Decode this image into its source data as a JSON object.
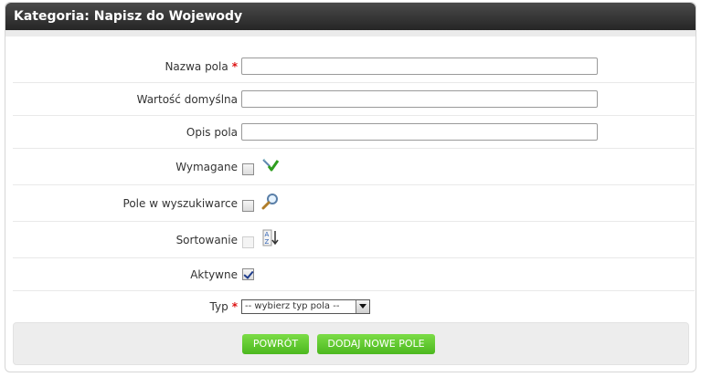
{
  "header": {
    "title": "Kategoria: Napisz do Wojewody"
  },
  "fields": {
    "nazwa": {
      "label": "Nazwa pola",
      "required_mark": "*",
      "value": ""
    },
    "wartosc": {
      "label": "Wartość domyślna",
      "value": ""
    },
    "opis": {
      "label": "Opis pola",
      "value": ""
    },
    "wymagane": {
      "label": "Wymagane",
      "checked": false,
      "icon": "required-check-icon"
    },
    "wyszukiwarka": {
      "label": "Pole w wyszukiwarce",
      "checked": false,
      "icon": "magnifier-icon"
    },
    "sortowanie": {
      "label": "Sortowanie",
      "checked": false,
      "disabled": true,
      "icon": "sort-az-icon"
    },
    "aktywne": {
      "label": "Aktywne",
      "checked": true
    },
    "typ": {
      "label": "Typ",
      "required_mark": "*",
      "selected": "-- wybierz typ pola --"
    }
  },
  "buttons": {
    "back": "POWRÓT",
    "add": "DODAJ NOWE POLE"
  },
  "colors": {
    "header_bg": "#2e2e2e",
    "button_green": "#5cc92e",
    "required": "#dd1111"
  }
}
